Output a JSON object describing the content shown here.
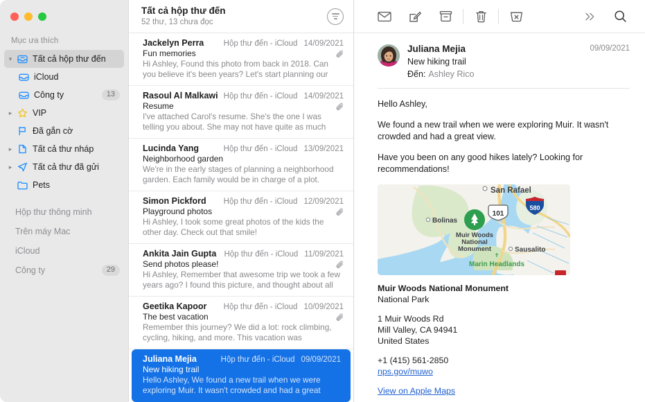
{
  "window": {
    "traffic_lights": [
      "close",
      "minimize",
      "zoom"
    ],
    "accent_color": "#1472e6"
  },
  "sidebar": {
    "sections": [
      {
        "label": "Mục ưa thích"
      }
    ],
    "favorites": [
      {
        "label": "Tất cả hộp thư đến",
        "icon": "inbox-icon",
        "disclosure": "v",
        "selected": true,
        "badge": ""
      },
      {
        "label": "iCloud",
        "icon": "inbox-icon",
        "disclosure": "",
        "indent": 1,
        "badge": ""
      },
      {
        "label": "Công ty",
        "icon": "inbox-icon",
        "disclosure": "",
        "indent": 1,
        "badge": "13"
      },
      {
        "label": "VIP",
        "icon": "star-icon",
        "disclosure": ">",
        "badge": ""
      },
      {
        "label": "Đã gắn cờ",
        "icon": "flag-icon",
        "disclosure": "",
        "badge": ""
      },
      {
        "label": "Tất cả thư nháp",
        "icon": "draft-icon",
        "disclosure": ">",
        "badge": ""
      },
      {
        "label": "Tất cả thư đã gửi",
        "icon": "sent-icon",
        "disclosure": ">",
        "badge": ""
      },
      {
        "label": "Pets",
        "icon": "folder-icon",
        "disclosure": "",
        "badge": ""
      }
    ],
    "groups": [
      {
        "label": "Hộp thư thông minh",
        "badge": ""
      },
      {
        "label": "Trên máy Mac",
        "badge": ""
      },
      {
        "label": "iCloud",
        "badge": ""
      },
      {
        "label": "Công ty",
        "badge": "29"
      }
    ]
  },
  "list_header": {
    "title": "Tất cả hộp thư đến",
    "subtitle": "52 thư, 13 chưa đọc",
    "filter_icon": "filter-icon"
  },
  "messages": [
    {
      "from": "Jackelyn Perra",
      "mailbox": "Hộp thư đến - iCloud",
      "date": "14/09/2021",
      "subject": "Fun memories",
      "preview": "Hi Ashley, Found this photo from back in 2018. Can you believe it's been years? Let's start planning our next a...",
      "attachment": true,
      "selected": false
    },
    {
      "from": "Rasoul Al Malkawi",
      "mailbox": "Hộp thư đến - iCloud",
      "date": "14/09/2021",
      "subject": "Resume",
      "preview": "I've attached Carol's resume. She's the one I was telling you about. She may not have quite as much experienc...",
      "attachment": true,
      "selected": false
    },
    {
      "from": "Lucinda Yang",
      "mailbox": "Hộp thư đến - iCloud",
      "date": "13/09/2021",
      "subject": "Neighborhood garden",
      "preview": "We're in the early stages of planning a neighborhood garden. Each family would be in charge of a plot. Bring...",
      "attachment": false,
      "selected": false
    },
    {
      "from": "Simon Pickford",
      "mailbox": "Hộp thư đến - iCloud",
      "date": "12/09/2021",
      "subject": "Playground photos",
      "preview": "Hi Ashley, I took some great photos of the kids the other day. Check out that smile!",
      "attachment": true,
      "selected": false
    },
    {
      "from": "Ankita Jain Gupta",
      "mailbox": "Hộp thư đến - iCloud",
      "date": "11/09/2021",
      "subject": "Send photos please!",
      "preview": "Hi Ashley, Remember that awesome trip we took a few years ago? I found this picture, and thought about all y...",
      "attachment": true,
      "selected": false
    },
    {
      "from": "Geetika Kapoor",
      "mailbox": "Hộp thư đến - iCloud",
      "date": "10/09/2021",
      "subject": "The best vacation",
      "preview": "Remember this journey? We did a lot: rock climbing, cycling, hiking, and more. This vacation was amazing....",
      "attachment": true,
      "selected": false
    },
    {
      "from": "Juliana Mejia",
      "mailbox": "Hộp thư đến - iCloud",
      "date": "09/09/2021",
      "subject": "New hiking trail",
      "preview": "Hello Ashley, We found a new trail when we were exploring Muir. It wasn't crowded and had a great view....",
      "attachment": false,
      "selected": true
    }
  ],
  "toolbar": {
    "buttons": [
      {
        "name": "mark-unread-button",
        "icon": "envelope-icon"
      },
      {
        "name": "compose-button",
        "icon": "compose-icon"
      },
      {
        "name": "archive-button",
        "icon": "archive-icon"
      },
      {
        "name": "delete-button",
        "icon": "trash-icon"
      },
      {
        "name": "junk-button",
        "icon": "junk-icon"
      },
      {
        "name": "more-button",
        "icon": "chevron-double-right-icon"
      },
      {
        "name": "search-button",
        "icon": "search-icon"
      }
    ]
  },
  "reader": {
    "sender": "Juliana Mejia",
    "subject": "New hiking trail",
    "to_label": "Đến:",
    "to_value": "Ashley Rico",
    "date": "09/09/2021",
    "body": [
      "Hello Ashley,",
      "We found a new trail when we were exploring Muir. It wasn't crowded and had a great view.",
      "Have you been on any good hikes lately? Looking for recommendations!"
    ],
    "map": {
      "labels": {
        "san_rafael": "San Rafael",
        "bolinas": "Bolinas",
        "sausalito": "Sausalito",
        "marin_headlands": "Marin Headlands",
        "muir_woods": "Muir Woods\nNational\nMonument",
        "muir_line1": "Muir Woods",
        "muir_line2": "National",
        "muir_line3": "Monument",
        "route_101": "101",
        "route_101_shield": "US",
        "route_580": "580"
      },
      "colors": {
        "water": "#a8d8f0",
        "land": "#f3f1ec",
        "park": "#d8e8c8",
        "road": "#f6d98e",
        "pin": "#2e9e4f"
      }
    },
    "place": {
      "title": "Muir Woods National Monument",
      "category": "National Park",
      "address_line1": "1 Muir Woods Rd",
      "address_line2": "Mill Valley, CA 94941",
      "address_line3": "United States",
      "phone": "+1 (415) 561-2850",
      "website": "nps.gov/muwo",
      "maps_link": "View on Apple Maps"
    }
  }
}
